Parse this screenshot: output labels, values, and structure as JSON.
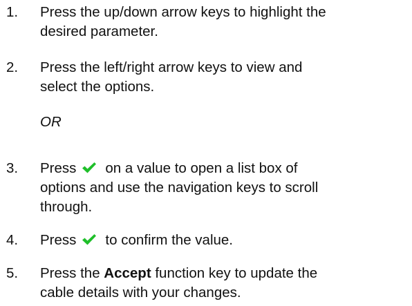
{
  "colors": {
    "check": "#1fbf2a",
    "text": "#111111"
  },
  "steps": [
    {
      "number": "1.",
      "lines": [
        "Press the up/down arrow keys to highlight the",
        "desired parameter."
      ]
    },
    {
      "number": "2.",
      "lines": [
        "Press the left/right arrow keys to view and",
        "select the options."
      ]
    },
    {
      "number": "3.",
      "before_icon": "Press",
      "icon": "checkmark-icon",
      "after_icon": "on a value to open a list box of",
      "lines": [
        "options and use the navigation keys to scroll",
        "through."
      ]
    },
    {
      "number": "4.",
      "before_icon": "Press",
      "icon": "checkmark-icon",
      "after_icon": "to confirm the value."
    },
    {
      "number": "5.",
      "before_bold": "Press the ",
      "bold": "Accept",
      "after_bold": " function key to update the",
      "lines": [
        "cable details with your changes."
      ]
    }
  ],
  "or_label": "OR"
}
